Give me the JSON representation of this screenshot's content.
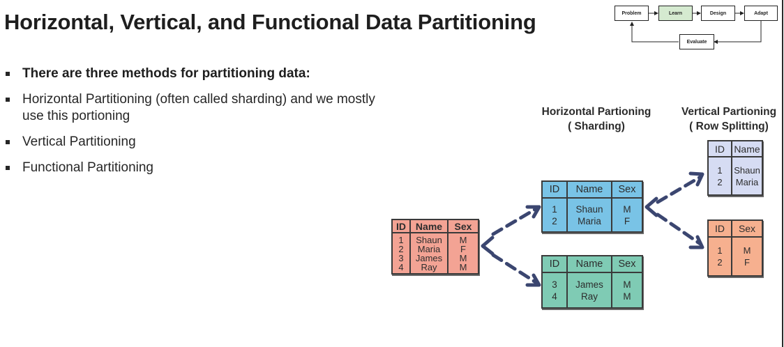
{
  "title": "Horizontal, Vertical, and Functional Data Partitioning",
  "flow": {
    "problem": "Problem",
    "learn": "Learn",
    "design": "Design",
    "adapt": "Adapt",
    "evaluate": "Evaluate"
  },
  "bullets": [
    "There are three methods for partitioning data:",
    "Horizontal Partitioning (often called sharding) and we mostly use this portioning",
    "Vertical Partitioning",
    "Functional Partitioning"
  ],
  "captions": {
    "horizontal": "Horizontal Partioning\n( Sharding)",
    "vertical": "Vertical Partioning\n( Row Splitting)"
  },
  "tables": {
    "source": {
      "headers": [
        "ID",
        "Name",
        "Sex"
      ],
      "cols": [
        [
          "1",
          "2",
          "3",
          "4"
        ],
        [
          "Shaun",
          "Maria",
          "James",
          "Ray"
        ],
        [
          "M",
          "F",
          "M",
          "M"
        ]
      ]
    },
    "shard1": {
      "headers": [
        "ID",
        "Name",
        "Sex"
      ],
      "cols": [
        [
          "1",
          "2"
        ],
        [
          "Shaun",
          "Maria"
        ],
        [
          "M",
          "F"
        ]
      ]
    },
    "shard2": {
      "headers": [
        "ID",
        "Name",
        "Sex"
      ],
      "cols": [
        [
          "3",
          "4"
        ],
        [
          "James",
          "Ray"
        ],
        [
          "M",
          "M"
        ]
      ]
    },
    "vert1": {
      "headers": [
        "ID",
        "Name"
      ],
      "cols": [
        [
          "1",
          "2"
        ],
        [
          "Shaun",
          "Maria"
        ]
      ]
    },
    "vert2": {
      "headers": [
        "ID",
        "Sex"
      ],
      "cols": [
        [
          "1",
          "2"
        ],
        [
          "M",
          "F"
        ]
      ]
    }
  },
  "colors": {
    "source": "#f3a394",
    "shard1": "#79c3e6",
    "shard2": "#7fcbb4",
    "vert1": "#d6dcf3",
    "vert2": "#f6b08f",
    "arrow": "#3b4670",
    "learn": "#d5ead0"
  }
}
